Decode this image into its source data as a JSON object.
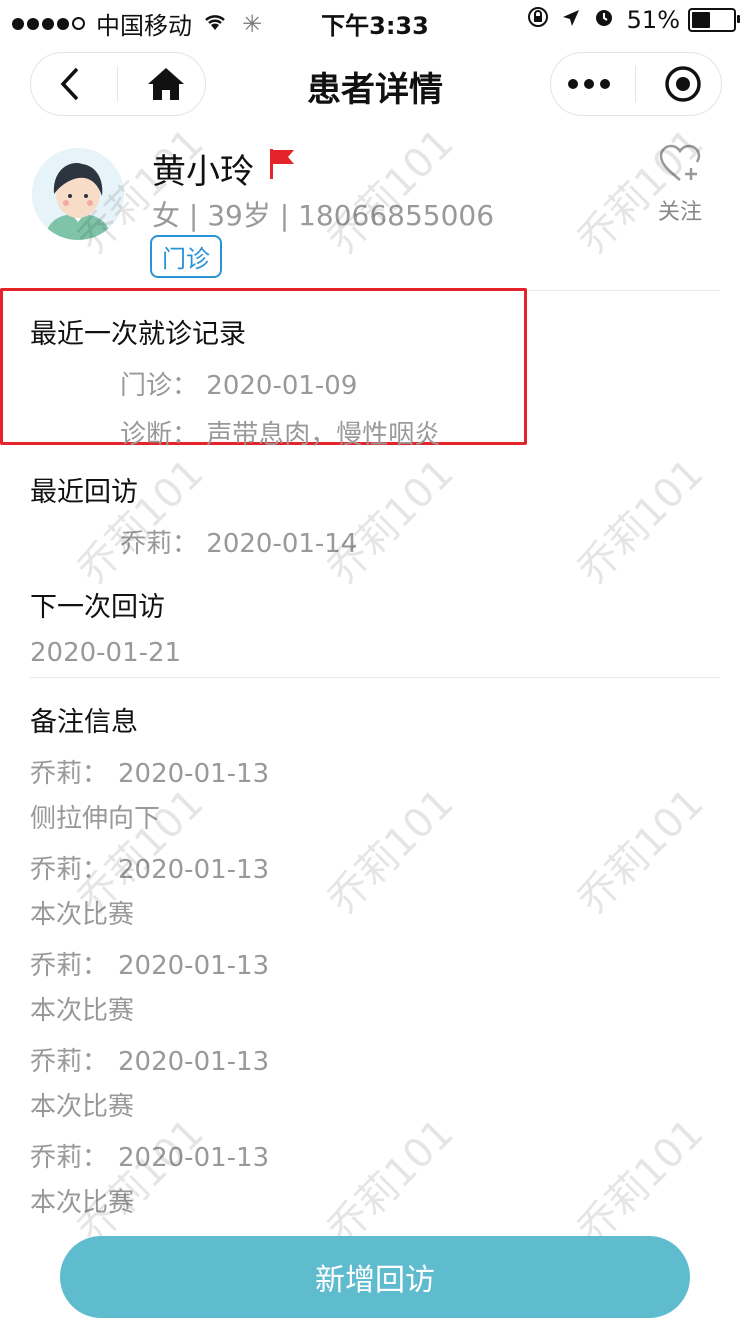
{
  "status_bar": {
    "carrier": "中国移动",
    "time": "下午3:33",
    "battery": "51%",
    "battery_level": 0.51
  },
  "nav": {
    "title": "患者详情"
  },
  "patient": {
    "name": "黄小玲",
    "info": "女 | 39岁 | 18066855006",
    "tag": "门诊",
    "follow_label": "关注"
  },
  "last_visit": {
    "title": "最近一次就诊记录",
    "visit_label": "门诊：",
    "visit_date": "2020-01-09",
    "diagnosis_label": "诊断：",
    "diagnosis": "声带息肉，慢性咽炎"
  },
  "recent_followup": {
    "title": "最近回访",
    "who": "乔莉：",
    "date": "2020-01-14"
  },
  "next_followup": {
    "title": "下一次回访",
    "date": "2020-01-21"
  },
  "notes": {
    "title": "备注信息",
    "items": [
      {
        "author": "乔莉：",
        "date": "2020-01-13",
        "text": "侧拉伸向下"
      },
      {
        "author": "乔莉：",
        "date": "2020-01-13",
        "text": "本次比赛"
      },
      {
        "author": "乔莉：",
        "date": "2020-01-13",
        "text": "本次比赛"
      },
      {
        "author": "乔莉：",
        "date": "2020-01-13",
        "text": "本次比赛"
      },
      {
        "author": "乔莉：",
        "date": "2020-01-13",
        "text": "本次比赛"
      }
    ]
  },
  "watermark": "乔莉101",
  "action": {
    "add_label": "新增回访"
  },
  "colors": {
    "primary_button": "#5fbccf",
    "tag": "#2a93d5",
    "highlight": "#e5232a"
  }
}
